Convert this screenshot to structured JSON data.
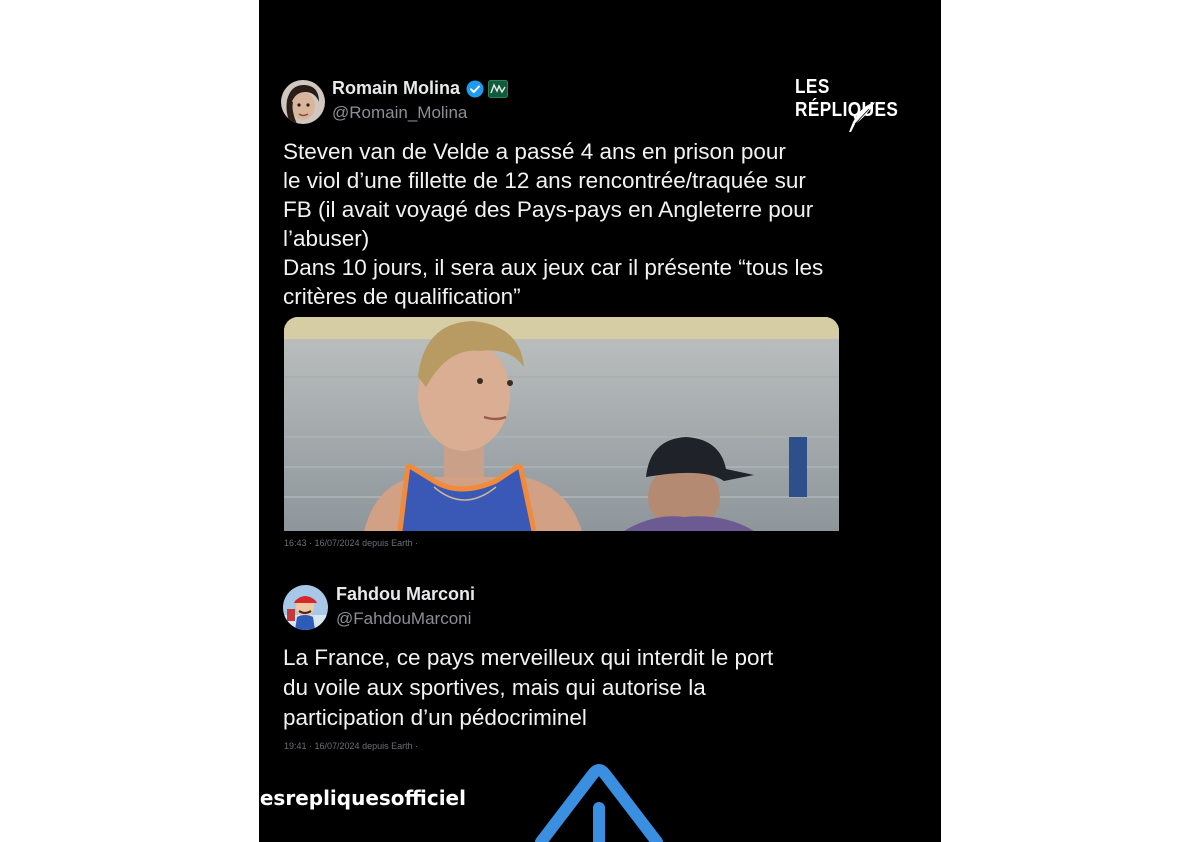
{
  "tweet1": {
    "name": "Romain Molina",
    "handle": "@Romain_Molina",
    "text_lines": [
      "Steven van de Velde a passé 4 ans en prison pour",
      "le viol d’une fillette de 12 ans rencontrée/traquée sur",
      "FB (il avait voyagé des Pays-pays en Angleterre pour",
      "l’abuser)",
      "Dans 10 jours, il sera aux jeux car il présente “tous les",
      "critères de qualification”"
    ],
    "meta": "16:43 · 16/07/2024 depuis Earth ·"
  },
  "tweet2": {
    "name": "Fahdou Marconi",
    "handle": "@FahdouMarconi",
    "text_lines": [
      "La France, ce pays merveilleux qui interdit le port",
      "du voile aux sportives, mais qui autorise la",
      "participation d’un pédocriminel"
    ],
    "meta": "19:41 · 16/07/2024 depuis Earth ·"
  },
  "brand": {
    "logo_text": "LES RÉPLIQUES"
  },
  "watermark": {
    "text": "lesrepliquesofficiel"
  },
  "icons": {
    "verified": "verified-badge-icon",
    "affiliate": "affiliate-badge-icon",
    "quill": "quill-icon",
    "arrow": "swipe-up-arrow-icon"
  },
  "colors": {
    "background": "#000000",
    "verified": "#1d9bf0",
    "text": "#f2f2f2",
    "muted": "#8b8f94",
    "arrow": "#3b8fe0"
  }
}
